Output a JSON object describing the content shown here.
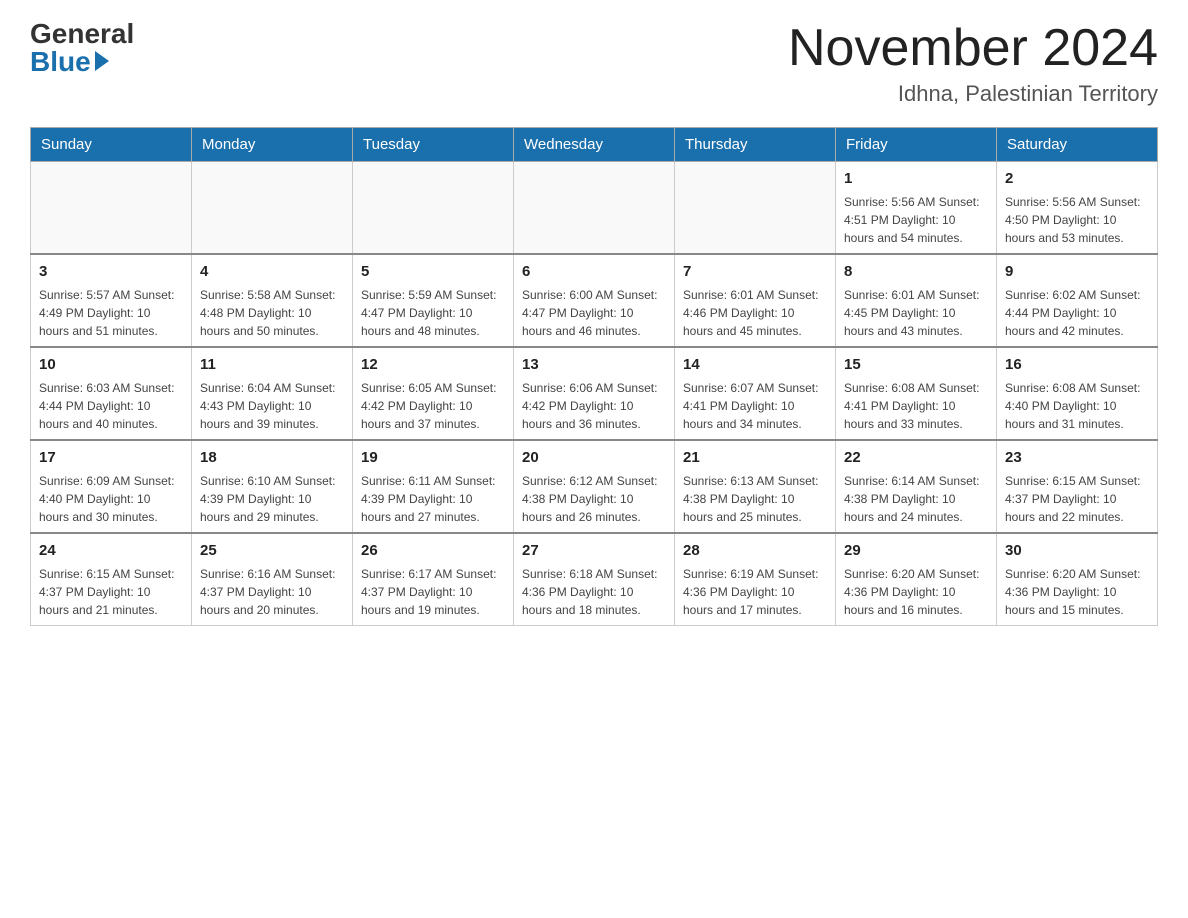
{
  "header": {
    "logo_general": "General",
    "logo_blue": "Blue",
    "month_title": "November 2024",
    "location": "Idhna, Palestinian Territory"
  },
  "days_of_week": [
    "Sunday",
    "Monday",
    "Tuesday",
    "Wednesday",
    "Thursday",
    "Friday",
    "Saturday"
  ],
  "weeks": [
    [
      {
        "day": "",
        "info": ""
      },
      {
        "day": "",
        "info": ""
      },
      {
        "day": "",
        "info": ""
      },
      {
        "day": "",
        "info": ""
      },
      {
        "day": "",
        "info": ""
      },
      {
        "day": "1",
        "info": "Sunrise: 5:56 AM\nSunset: 4:51 PM\nDaylight: 10 hours and 54 minutes."
      },
      {
        "day": "2",
        "info": "Sunrise: 5:56 AM\nSunset: 4:50 PM\nDaylight: 10 hours and 53 minutes."
      }
    ],
    [
      {
        "day": "3",
        "info": "Sunrise: 5:57 AM\nSunset: 4:49 PM\nDaylight: 10 hours and 51 minutes."
      },
      {
        "day": "4",
        "info": "Sunrise: 5:58 AM\nSunset: 4:48 PM\nDaylight: 10 hours and 50 minutes."
      },
      {
        "day": "5",
        "info": "Sunrise: 5:59 AM\nSunset: 4:47 PM\nDaylight: 10 hours and 48 minutes."
      },
      {
        "day": "6",
        "info": "Sunrise: 6:00 AM\nSunset: 4:47 PM\nDaylight: 10 hours and 46 minutes."
      },
      {
        "day": "7",
        "info": "Sunrise: 6:01 AM\nSunset: 4:46 PM\nDaylight: 10 hours and 45 minutes."
      },
      {
        "day": "8",
        "info": "Sunrise: 6:01 AM\nSunset: 4:45 PM\nDaylight: 10 hours and 43 minutes."
      },
      {
        "day": "9",
        "info": "Sunrise: 6:02 AM\nSunset: 4:44 PM\nDaylight: 10 hours and 42 minutes."
      }
    ],
    [
      {
        "day": "10",
        "info": "Sunrise: 6:03 AM\nSunset: 4:44 PM\nDaylight: 10 hours and 40 minutes."
      },
      {
        "day": "11",
        "info": "Sunrise: 6:04 AM\nSunset: 4:43 PM\nDaylight: 10 hours and 39 minutes."
      },
      {
        "day": "12",
        "info": "Sunrise: 6:05 AM\nSunset: 4:42 PM\nDaylight: 10 hours and 37 minutes."
      },
      {
        "day": "13",
        "info": "Sunrise: 6:06 AM\nSunset: 4:42 PM\nDaylight: 10 hours and 36 minutes."
      },
      {
        "day": "14",
        "info": "Sunrise: 6:07 AM\nSunset: 4:41 PM\nDaylight: 10 hours and 34 minutes."
      },
      {
        "day": "15",
        "info": "Sunrise: 6:08 AM\nSunset: 4:41 PM\nDaylight: 10 hours and 33 minutes."
      },
      {
        "day": "16",
        "info": "Sunrise: 6:08 AM\nSunset: 4:40 PM\nDaylight: 10 hours and 31 minutes."
      }
    ],
    [
      {
        "day": "17",
        "info": "Sunrise: 6:09 AM\nSunset: 4:40 PM\nDaylight: 10 hours and 30 minutes."
      },
      {
        "day": "18",
        "info": "Sunrise: 6:10 AM\nSunset: 4:39 PM\nDaylight: 10 hours and 29 minutes."
      },
      {
        "day": "19",
        "info": "Sunrise: 6:11 AM\nSunset: 4:39 PM\nDaylight: 10 hours and 27 minutes."
      },
      {
        "day": "20",
        "info": "Sunrise: 6:12 AM\nSunset: 4:38 PM\nDaylight: 10 hours and 26 minutes."
      },
      {
        "day": "21",
        "info": "Sunrise: 6:13 AM\nSunset: 4:38 PM\nDaylight: 10 hours and 25 minutes."
      },
      {
        "day": "22",
        "info": "Sunrise: 6:14 AM\nSunset: 4:38 PM\nDaylight: 10 hours and 24 minutes."
      },
      {
        "day": "23",
        "info": "Sunrise: 6:15 AM\nSunset: 4:37 PM\nDaylight: 10 hours and 22 minutes."
      }
    ],
    [
      {
        "day": "24",
        "info": "Sunrise: 6:15 AM\nSunset: 4:37 PM\nDaylight: 10 hours and 21 minutes."
      },
      {
        "day": "25",
        "info": "Sunrise: 6:16 AM\nSunset: 4:37 PM\nDaylight: 10 hours and 20 minutes."
      },
      {
        "day": "26",
        "info": "Sunrise: 6:17 AM\nSunset: 4:37 PM\nDaylight: 10 hours and 19 minutes."
      },
      {
        "day": "27",
        "info": "Sunrise: 6:18 AM\nSunset: 4:36 PM\nDaylight: 10 hours and 18 minutes."
      },
      {
        "day": "28",
        "info": "Sunrise: 6:19 AM\nSunset: 4:36 PM\nDaylight: 10 hours and 17 minutes."
      },
      {
        "day": "29",
        "info": "Sunrise: 6:20 AM\nSunset: 4:36 PM\nDaylight: 10 hours and 16 minutes."
      },
      {
        "day": "30",
        "info": "Sunrise: 6:20 AM\nSunset: 4:36 PM\nDaylight: 10 hours and 15 minutes."
      }
    ]
  ]
}
